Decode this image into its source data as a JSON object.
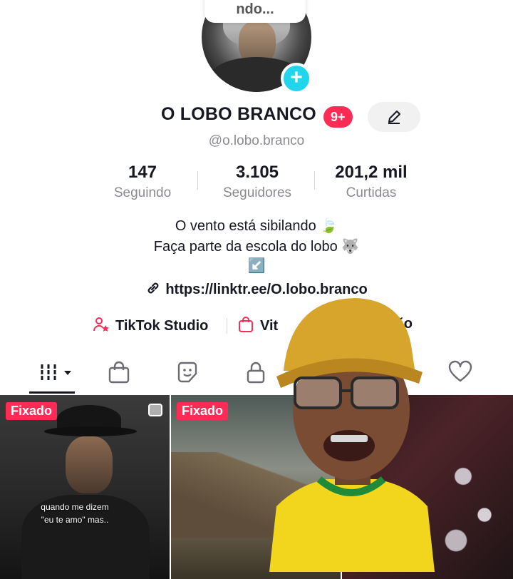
{
  "profile": {
    "note": "ndo...",
    "name": "O LOBO BRANCO",
    "notif_count": "9+",
    "handle": "@o.lobo.branco",
    "stats": [
      {
        "value": "147",
        "label": "Seguindo"
      },
      {
        "value": "3.105",
        "label": "Seguidores"
      },
      {
        "value": "201,2 mil",
        "label": "Curtidas"
      }
    ],
    "bio": [
      "O vento está sibilando 🍃",
      "Faça parte da escola do lobo 🐺",
      "↙️"
    ],
    "link": "https://linktr.ee/O.lobo.branco"
  },
  "actions": {
    "studio": "TikTok Studio",
    "shop": "Vit",
    "shop_tail": "crição"
  },
  "tabs": [
    "videos-grid-icon",
    "shop-bag-icon",
    "sticker-icon",
    "lock-icon",
    "bookmark-icon",
    "heart-icon"
  ],
  "grid": {
    "pinned_label": "Fixado",
    "caption_1": "quando me dizem",
    "caption_2": "\"eu te amo\" mas..",
    "partial_pin": "o"
  },
  "colors": {
    "accent": "#fe2c55",
    "add": "#20d5ec",
    "muted": "#8a8b91"
  }
}
